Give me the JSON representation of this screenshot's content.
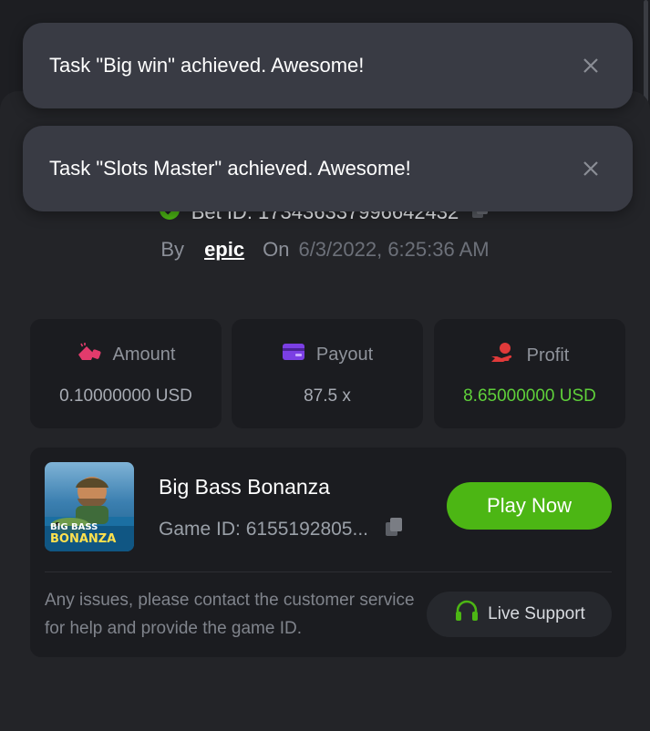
{
  "toasts": [
    {
      "message": "Task \"Big win\" achieved. Awesome!"
    },
    {
      "message": "Task \"Slots Master\" achieved. Awesome!"
    }
  ],
  "bet": {
    "id_label": "Bet ID: 173436337996642432",
    "by_label": "By",
    "user": "epic",
    "on_label": "On",
    "date": "6/3/2022, 6:25:36 AM"
  },
  "stats": {
    "amount": {
      "label": "Amount",
      "value": "0.10000000 USD"
    },
    "payout": {
      "label": "Payout",
      "value": "87.5 x"
    },
    "profit": {
      "label": "Profit",
      "value": "8.65000000 USD"
    }
  },
  "game": {
    "name": "Big Bass Bonanza",
    "id_text": "Game ID: 6155192805...",
    "thumb_line1": "BIG BASS",
    "thumb_line2": "BONANZA",
    "play_label": "Play Now",
    "support_text": "Any issues, please contact the customer service for help and provide the game ID.",
    "support_label": "Live Support"
  },
  "colors": {
    "accent_green": "#4cb614",
    "profit_green": "#5fd03a",
    "amount_icon": "#e23b6c",
    "payout_icon": "#7b3fe4",
    "profit_icon": "#e03a3a"
  },
  "icons": [
    "close-icon",
    "verified-check-icon",
    "copy-icon",
    "amount-icon",
    "payout-card-icon",
    "profit-hand-icon",
    "headset-icon"
  ]
}
